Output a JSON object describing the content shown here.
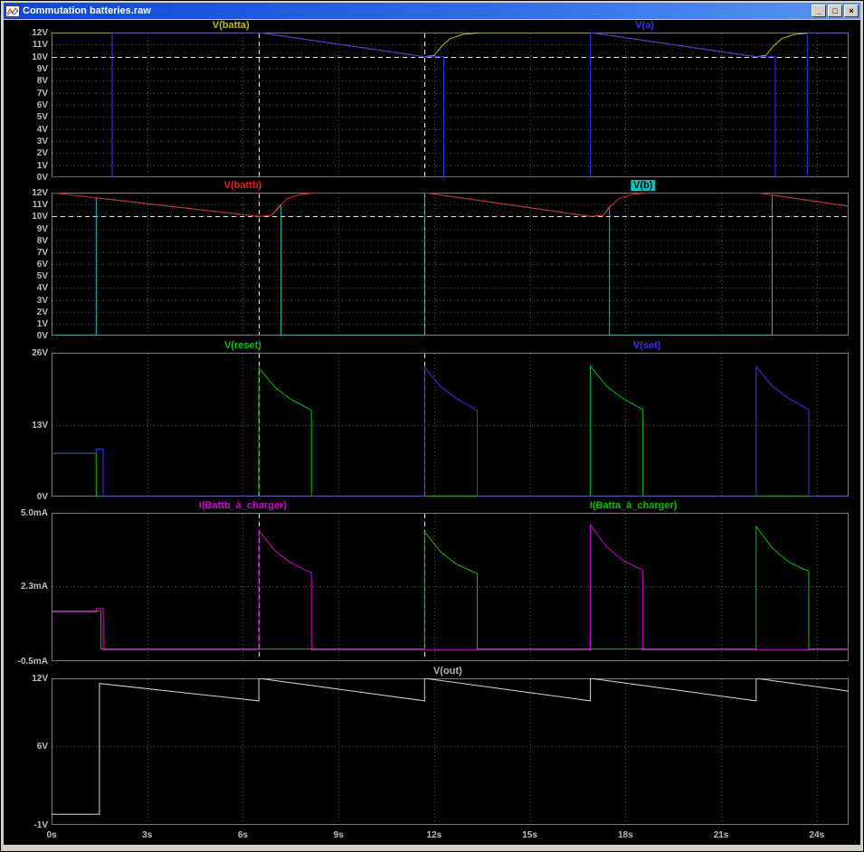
{
  "window": {
    "title": "Commutation batteries.raw",
    "icon_name": "waveform-icon",
    "controls": {
      "minimize": "_",
      "maximize": "□",
      "close": "×"
    }
  },
  "colors": {
    "background": "#000000",
    "grid": "#555555",
    "cursor": "#e6e6e6",
    "pane_border": "#7a7a7a",
    "axis_text": "#bdbdbd",
    "titlebar_left": "#0f45d8",
    "titlebar_right": "#5a95f2"
  },
  "chart_data": {
    "type": "line",
    "x_axis": {
      "label": "time",
      "min": 0,
      "max": 25,
      "unit": "s",
      "ticks": [
        {
          "t": 0,
          "label": "0s"
        },
        {
          "t": 3,
          "label": "3s"
        },
        {
          "t": 6,
          "label": "6s"
        },
        {
          "t": 9,
          "label": "9s"
        },
        {
          "t": 12,
          "label": "12s"
        },
        {
          "t": 15,
          "label": "15s"
        },
        {
          "t": 18,
          "label": "18s"
        },
        {
          "t": 21,
          "label": "21s"
        },
        {
          "t": 24,
          "label": "24s"
        }
      ]
    },
    "panes": [
      {
        "name": "pane-batta",
        "y_axis": {
          "min": 0,
          "max": 12,
          "ticks": [
            {
              "v": 12,
              "label": "12V"
            },
            {
              "v": 11,
              "label": "11V"
            },
            {
              "v": 10,
              "label": "10V"
            },
            {
              "v": 9,
              "label": "9V"
            },
            {
              "v": 8,
              "label": "8V"
            },
            {
              "v": 7,
              "label": "7V"
            },
            {
              "v": 6,
              "label": "6V"
            },
            {
              "v": 5,
              "label": "5V"
            },
            {
              "v": 4,
              "label": "4V"
            },
            {
              "v": 3,
              "label": "3V"
            },
            {
              "v": 2,
              "label": "2V"
            },
            {
              "v": 1,
              "label": "1V"
            },
            {
              "v": 0,
              "label": "0V"
            }
          ]
        },
        "labels": [
          {
            "text": "V(batta)",
            "color": "#bebe00",
            "x_frac": 0.225,
            "selected": false
          },
          {
            "text": "V(a)",
            "color": "#3535f5",
            "x_frac": 0.744,
            "selected": false
          }
        ],
        "cursors_v": [
          6.5,
          11.7
        ],
        "cursors_h": [
          10
        ],
        "series": [
          {
            "name": "V(batta)",
            "color": "#bebe00",
            "points": [
              [
                0,
                12
              ],
              [
                6.5,
                12
              ],
              [
                11.7,
                10
              ],
              [
                12.0,
                10.1
              ],
              [
                12.25,
                10.9
              ],
              [
                12.5,
                11.5
              ],
              [
                12.9,
                11.85
              ],
              [
                13.5,
                12
              ],
              [
                16.9,
                12
              ],
              [
                22.1,
                10
              ],
              [
                22.4,
                10.1
              ],
              [
                22.65,
                10.9
              ],
              [
                22.9,
                11.5
              ],
              [
                23.3,
                11.85
              ],
              [
                23.9,
                12
              ],
              [
                25,
                12
              ]
            ]
          },
          {
            "name": "V(a)",
            "color": "#3535f5",
            "points": [
              [
                0,
                0
              ],
              [
                1.9,
                0
              ],
              [
                1.9,
                12
              ],
              [
                6.5,
                12
              ],
              [
                11.7,
                10
              ],
              [
                12.3,
                10
              ],
              [
                12.3,
                0
              ],
              [
                16.9,
                0
              ],
              [
                16.9,
                12
              ],
              [
                22.1,
                10
              ],
              [
                22.7,
                10
              ],
              [
                22.7,
                0
              ],
              [
                23.7,
                0
              ],
              [
                23.7,
                12
              ],
              [
                25,
                12
              ]
            ]
          }
        ]
      },
      {
        "name": "pane-battb",
        "y_axis": {
          "min": 0,
          "max": 12,
          "ticks": [
            {
              "v": 12,
              "label": "12V"
            },
            {
              "v": 11,
              "label": "11V"
            },
            {
              "v": 10,
              "label": "10V"
            },
            {
              "v": 9,
              "label": "9V"
            },
            {
              "v": 8,
              "label": "8V"
            },
            {
              "v": 7,
              "label": "7V"
            },
            {
              "v": 6,
              "label": "6V"
            },
            {
              "v": 5,
              "label": "5V"
            },
            {
              "v": 4,
              "label": "4V"
            },
            {
              "v": 3,
              "label": "3V"
            },
            {
              "v": 2,
              "label": "2V"
            },
            {
              "v": 1,
              "label": "1V"
            },
            {
              "v": 0,
              "label": "0V"
            }
          ]
        },
        "labels": [
          {
            "text": "V(battb)",
            "color": "#e22222",
            "x_frac": 0.24,
            "selected": false
          },
          {
            "text": "V(b)",
            "color": "#00c8c8",
            "x_frac": 0.742,
            "selected": true
          }
        ],
        "cursors_v": [
          6.5,
          11.7
        ],
        "cursors_h": [
          10
        ],
        "series": [
          {
            "name": "V(b)",
            "color": "#00c8c8",
            "points": [
              [
                0,
                0
              ],
              [
                1.4,
                0
              ],
              [
                1.4,
                11.57
              ],
              [
                6.5,
                10
              ],
              [
                6.9,
                10.1
              ],
              [
                7.2,
                10.95
              ],
              [
                7.2,
                0
              ],
              [
                11.7,
                0
              ],
              [
                11.7,
                12
              ],
              [
                16.9,
                10
              ],
              [
                17.3,
                10.1
              ],
              [
                17.5,
                10.8
              ],
              [
                17.5,
                0
              ],
              [
                22.6,
                0
              ],
              [
                22.6,
                11.8
              ],
              [
                25,
                10.86
              ]
            ]
          },
          {
            "name": "V(battb)",
            "color": "#e22222",
            "points": [
              [
                0,
                12
              ],
              [
                6.5,
                10
              ],
              [
                6.9,
                10.1
              ],
              [
                7.15,
                10.9
              ],
              [
                7.4,
                11.5
              ],
              [
                7.8,
                11.85
              ],
              [
                8.4,
                12
              ],
              [
                11.7,
                12
              ],
              [
                16.9,
                10
              ],
              [
                17.3,
                10.1
              ],
              [
                17.55,
                10.9
              ],
              [
                17.8,
                11.5
              ],
              [
                18.2,
                11.85
              ],
              [
                18.8,
                12
              ],
              [
                22.1,
                12
              ],
              [
                25,
                10.86
              ]
            ]
          }
        ]
      },
      {
        "name": "pane-set-reset",
        "y_axis": {
          "min": 0,
          "max": 26,
          "ticks": [
            {
              "v": 26,
              "label": "26V"
            },
            {
              "v": 13,
              "label": "13V"
            },
            {
              "v": 0,
              "label": "0V"
            }
          ]
        },
        "labels": [
          {
            "text": "V(reset)",
            "color": "#00c800",
            "x_frac": 0.24,
            "selected": false
          },
          {
            "text": "V(set)",
            "color": "#3535f5",
            "x_frac": 0.747,
            "selected": false
          }
        ],
        "cursors_v": [
          6.5,
          11.7
        ],
        "cursors_h": [],
        "series": [
          {
            "name": "V(reset)",
            "color": "#00c800",
            "points": [
              [
                0,
                7.8
              ],
              [
                1.4,
                7.8
              ],
              [
                1.4,
                0
              ],
              [
                6.5,
                0
              ],
              [
                6.5,
                23.3
              ],
              [
                7.0,
                19.8
              ],
              [
                7.5,
                17.6
              ],
              [
                8.0,
                16.1
              ],
              [
                8.15,
                15.6
              ],
              [
                8.15,
                0
              ],
              [
                16.9,
                0
              ],
              [
                16.9,
                23.6
              ],
              [
                17.4,
                20.0
              ],
              [
                17.9,
                17.8
              ],
              [
                18.4,
                16.2
              ],
              [
                18.55,
                15.7
              ],
              [
                18.55,
                0
              ],
              [
                25,
                0
              ]
            ]
          },
          {
            "name": "V(set)",
            "color": "#3535f5",
            "points": [
              [
                0,
                7.8
              ],
              [
                1.4,
                7.8
              ],
              [
                1.4,
                8.6
              ],
              [
                1.62,
                8.6
              ],
              [
                1.62,
                0
              ],
              [
                11.7,
                0
              ],
              [
                11.7,
                23.4
              ],
              [
                12.2,
                19.9
              ],
              [
                12.7,
                17.7
              ],
              [
                13.2,
                16.1
              ],
              [
                13.35,
                15.6
              ],
              [
                13.35,
                0
              ],
              [
                22.1,
                0
              ],
              [
                22.1,
                23.5
              ],
              [
                22.6,
                20.0
              ],
              [
                23.1,
                17.8
              ],
              [
                23.6,
                16.2
              ],
              [
                23.75,
                15.7
              ],
              [
                23.75,
                0
              ],
              [
                25,
                0
              ]
            ]
          }
        ]
      },
      {
        "name": "pane-charge-currents",
        "y_axis": {
          "min": -0.5,
          "max": 5.0,
          "ticks": [
            {
              "v": 5.0,
              "label": "5.0mA"
            },
            {
              "v": 2.3,
              "label": "2.3mA"
            },
            {
              "v": -0.5,
              "label": "-0.5mA"
            }
          ]
        },
        "labels": [
          {
            "text": "I(Battb_à_charger)",
            "color": "#dd00dd",
            "x_frac": 0.24,
            "selected": false
          },
          {
            "text": "I(Batta_à_charger)",
            "color": "#00c800",
            "x_frac": 0.73,
            "selected": false
          }
        ],
        "cursors_v": [
          6.5,
          11.7
        ],
        "cursors_h": [],
        "series": [
          {
            "name": "I(Battb_à_charger)",
            "color": "#dd00dd",
            "points": [
              [
                0,
                1.32
              ],
              [
                1.4,
                1.32
              ],
              [
                1.4,
                1.45
              ],
              [
                1.62,
                1.45
              ],
              [
                1.62,
                -0.07
              ],
              [
                6.5,
                -0.07
              ],
              [
                6.5,
                4.35
              ],
              [
                7.0,
                3.6
              ],
              [
                7.5,
                3.15
              ],
              [
                8.0,
                2.85
              ],
              [
                8.15,
                2.78
              ],
              [
                8.15,
                -0.07
              ],
              [
                16.9,
                -0.07
              ],
              [
                16.9,
                4.55
              ],
              [
                17.4,
                3.75
              ],
              [
                17.9,
                3.25
              ],
              [
                18.4,
                2.95
              ],
              [
                18.55,
                2.88
              ],
              [
                18.55,
                -0.07
              ],
              [
                25,
                -0.07
              ]
            ]
          },
          {
            "name": "I(Batta_à_charger)",
            "color": "#00c800",
            "points": [
              [
                0,
                1.35
              ],
              [
                1.55,
                1.35
              ],
              [
                1.55,
                -0.05
              ],
              [
                11.7,
                -0.05
              ],
              [
                11.7,
                4.3
              ],
              [
                12.2,
                3.55
              ],
              [
                12.7,
                3.1
              ],
              [
                13.2,
                2.82
              ],
              [
                13.35,
                2.75
              ],
              [
                13.35,
                -0.05
              ],
              [
                22.1,
                -0.05
              ],
              [
                22.1,
                4.5
              ],
              [
                22.6,
                3.7
              ],
              [
                23.1,
                3.2
              ],
              [
                23.6,
                2.9
              ],
              [
                23.75,
                2.85
              ],
              [
                23.75,
                -0.05
              ],
              [
                25,
                -0.05
              ]
            ]
          }
        ]
      },
      {
        "name": "pane-out",
        "y_axis": {
          "min": -1,
          "max": 12,
          "ticks": [
            {
              "v": 12,
              "label": "12V"
            },
            {
              "v": 6,
              "label": "6V"
            },
            {
              "v": -1,
              "label": "-1V"
            }
          ]
        },
        "labels": [
          {
            "text": "V(out)",
            "color": "#b4b4b4",
            "x_frac": 0.497,
            "selected": false
          }
        ],
        "cursors_v": [],
        "cursors_h": [],
        "series": [
          {
            "name": "V(out)",
            "color": "#d8d8d8",
            "points": [
              [
                0,
                -0.05
              ],
              [
                1.5,
                -0.05
              ],
              [
                1.5,
                11.54
              ],
              [
                6.5,
                10
              ],
              [
                6.5,
                12
              ],
              [
                11.7,
                10
              ],
              [
                11.7,
                12
              ],
              [
                16.9,
                10
              ],
              [
                16.9,
                12
              ],
              [
                22.1,
                10
              ],
              [
                22.1,
                12
              ],
              [
                25,
                10.87
              ]
            ]
          }
        ]
      }
    ]
  }
}
